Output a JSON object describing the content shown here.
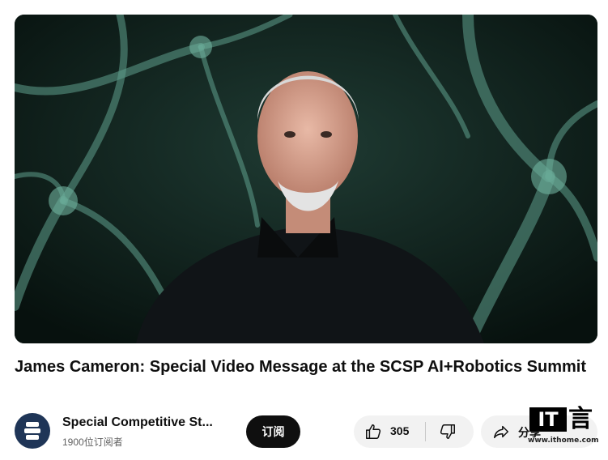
{
  "video": {
    "title": "James Cameron: Special Video Message at the SCSP AI+Robotics Summit"
  },
  "channel": {
    "name": "Special Competitive St...",
    "subscribers": "1900位订阅者",
    "subscribe_label": "订阅"
  },
  "actions": {
    "like_count": "305",
    "share_label": "分享"
  },
  "watermark": {
    "logo_text": "IT",
    "url": "www.ithome.com"
  },
  "colors": {
    "subscribe_bg": "#0f0f0f",
    "pill_bg": "#f2f2f2",
    "avatar_bg": "#1f3557"
  }
}
